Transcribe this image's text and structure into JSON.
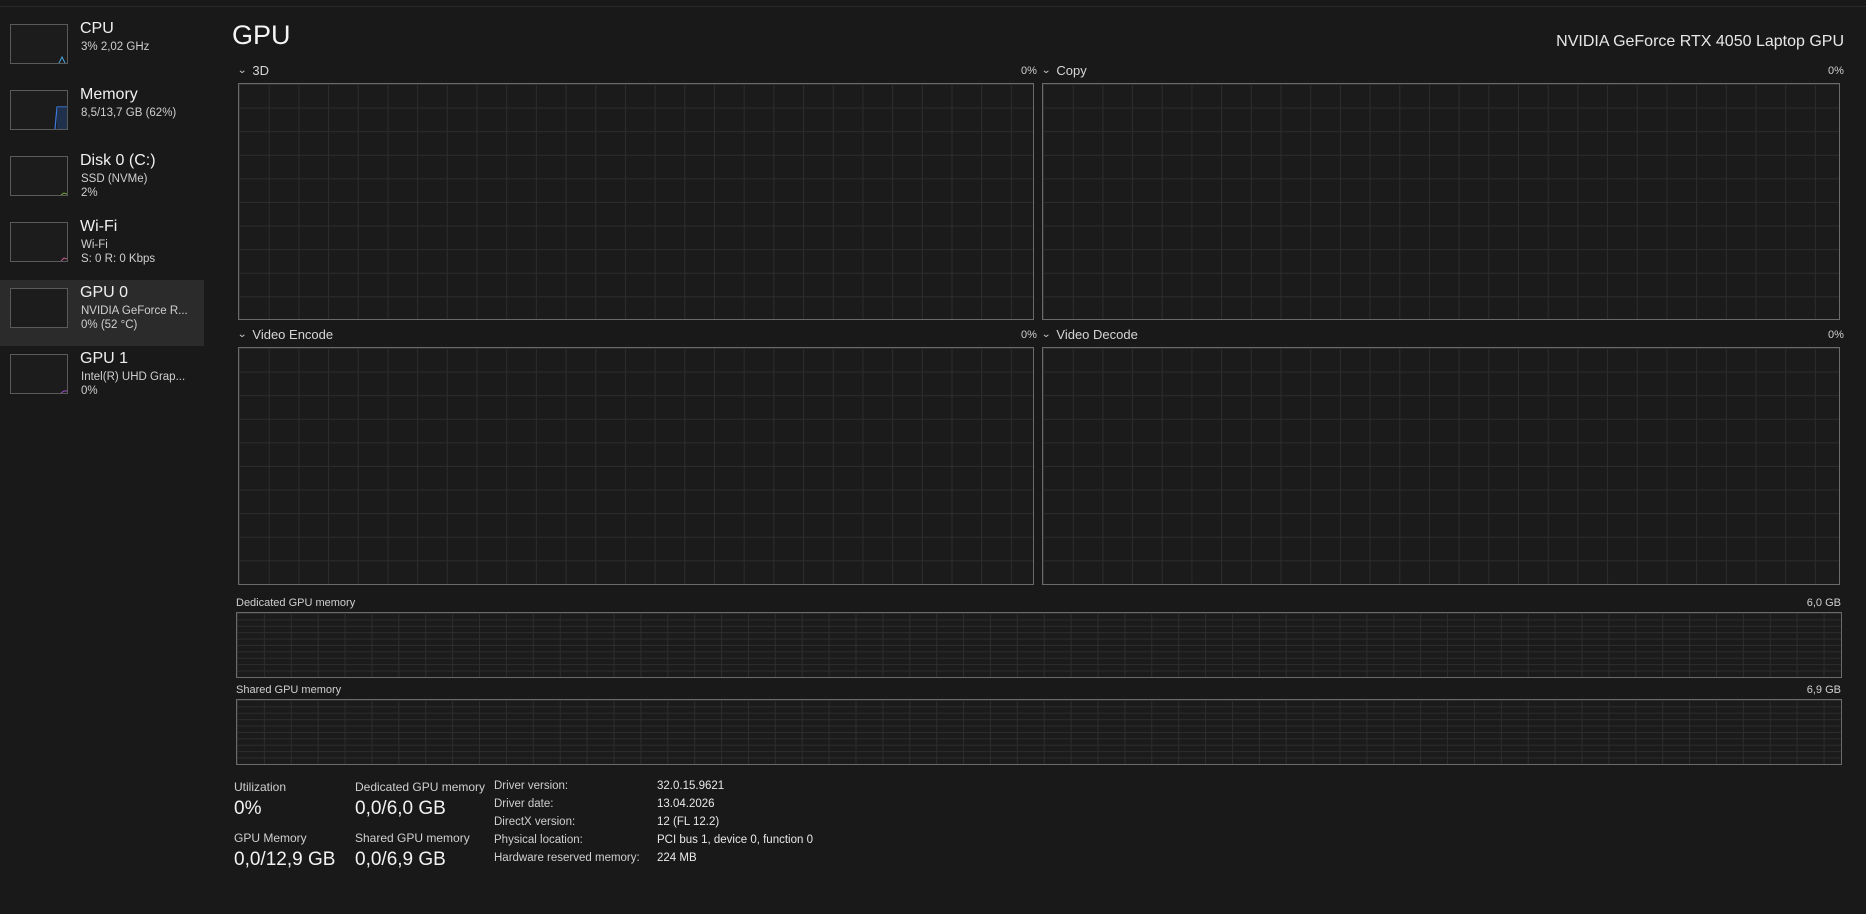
{
  "sidebar": {
    "items": [
      {
        "title": "CPU",
        "sub1": "3%  2,02 GHz",
        "sub2": "",
        "selected": false,
        "accent": "#4aa3df"
      },
      {
        "title": "Memory",
        "sub1": "8,5/13,7 GB (62%)",
        "sub2": "",
        "selected": false,
        "accent": "#3d7be0"
      },
      {
        "title": "Disk 0 (C:)",
        "sub1": "SSD (NVMe)",
        "sub2": "2%",
        "selected": false,
        "accent": "#6fae3b"
      },
      {
        "title": "Wi-Fi",
        "sub1": "Wi-Fi",
        "sub2": "S: 0  R: 0 Kbps",
        "selected": false,
        "accent": "#c0578a"
      },
      {
        "title": "GPU 0",
        "sub1": "NVIDIA GeForce R...",
        "sub2": "0%  (52 °C)",
        "selected": true,
        "accent": "#7a5cc7"
      },
      {
        "title": "GPU 1",
        "sub1": "Intel(R) UHD Grap...",
        "sub2": "0%",
        "selected": false,
        "accent": "#a04fd0"
      }
    ]
  },
  "header": {
    "title": "GPU",
    "model": "NVIDIA GeForce RTX 4050 Laptop GPU"
  },
  "engines": [
    {
      "name": "3D",
      "value": "0%"
    },
    {
      "name": "Copy",
      "value": "0%"
    },
    {
      "name": "Video Encode",
      "value": "0%"
    },
    {
      "name": "Video Decode",
      "value": "0%"
    }
  ],
  "memory_charts": {
    "dedicated": {
      "label": "Dedicated GPU memory",
      "max": "6,0 GB"
    },
    "shared": {
      "label": "Shared GPU memory",
      "max": "6,9 GB"
    }
  },
  "stats": {
    "utilization_label": "Utilization",
    "utilization_value": "0%",
    "dedicated_label": "Dedicated GPU memory",
    "dedicated_value": "0,0/6,0 GB",
    "gpu_memory_label": "GPU Memory",
    "gpu_memory_value": "0,0/12,9 GB",
    "shared_label": "Shared GPU memory",
    "shared_value": "0,0/6,9 GB"
  },
  "info": [
    {
      "label": "Driver version:",
      "value": "32.0.15.9621"
    },
    {
      "label": "Driver date:",
      "value": "13.04.2026"
    },
    {
      "label": "DirectX version:",
      "value": "12 (FL 12.2)"
    },
    {
      "label": "Physical location:",
      "value": "PCI bus 1, device 0, function 0"
    },
    {
      "label": "Hardware reserved memory:",
      "value": "224 MB"
    }
  ]
}
